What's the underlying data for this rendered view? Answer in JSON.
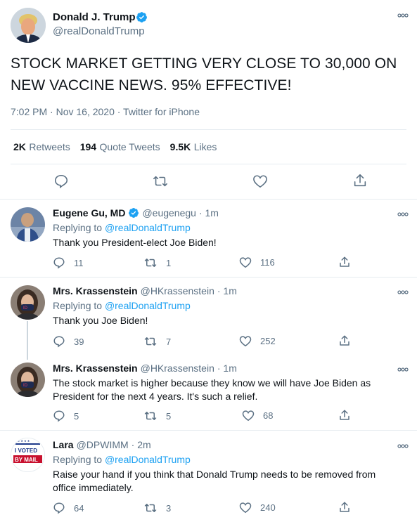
{
  "main_tweet": {
    "author_name": "Donald J. Trump",
    "author_handle": "@realDonaldTrump",
    "text_line1": "STOCK MARKET GETTING VERY CLOSE TO 30,000 ON",
    "text_line2": "NEW VACCINE NEWS. 95% EFFECTIVE!",
    "meta": "7:02 PM · Nov 16, 2020 · Twitter for iPhone",
    "stats": {
      "retweets_num": "2K",
      "retweets_label": "Retweets",
      "quotes_num": "194",
      "quotes_label": "Quote Tweets",
      "likes_num": "9.5K",
      "likes_label": "Likes"
    }
  },
  "replies": [
    {
      "name": "Eugene Gu, MD",
      "handle": "@eugenegu",
      "time": "· 1m",
      "replying_prefix": "Replying to",
      "replying_to": "@realDonaldTrump",
      "line1": "Thank you President-elect Joe Biden!",
      "replies": "11",
      "retweets": "1",
      "likes": "116"
    },
    {
      "name": "Mrs. Krassenstein",
      "handle": "@HKrassenstein",
      "time": "· 1m",
      "replying_prefix": "Replying to",
      "replying_to": "@realDonaldTrump",
      "line1": "Thank you Joe Biden!",
      "replies": "39",
      "retweets": "7",
      "likes": "252"
    },
    {
      "name": "Mrs. Krassenstein",
      "handle": "@HKrassenstein",
      "time": "· 1m",
      "line1": "The stock market is higher because they know we will have Joe Biden as",
      "line2": "President for the next 4 years.  It's such a relief.",
      "replies": "5",
      "retweets": "5",
      "likes": "68"
    },
    {
      "name": "Lara",
      "handle": "@DPWIMM",
      "time": "· 2m",
      "replying_prefix": "Replying to",
      "replying_to": "@realDonaldTrump",
      "line1": "Raise your hand if you think that Donald Trump needs to be removed from",
      "line2": "office immediately.",
      "replies": "64",
      "retweets": "3",
      "likes": "240",
      "avatar_text_top": "I VOTED",
      "avatar_text_bottom": "BY MAIL"
    }
  ],
  "colors": {
    "verified": "#1da1f2",
    "link": "#1da1f2",
    "muted": "#5b7083",
    "divider": "#e6ecf0"
  }
}
